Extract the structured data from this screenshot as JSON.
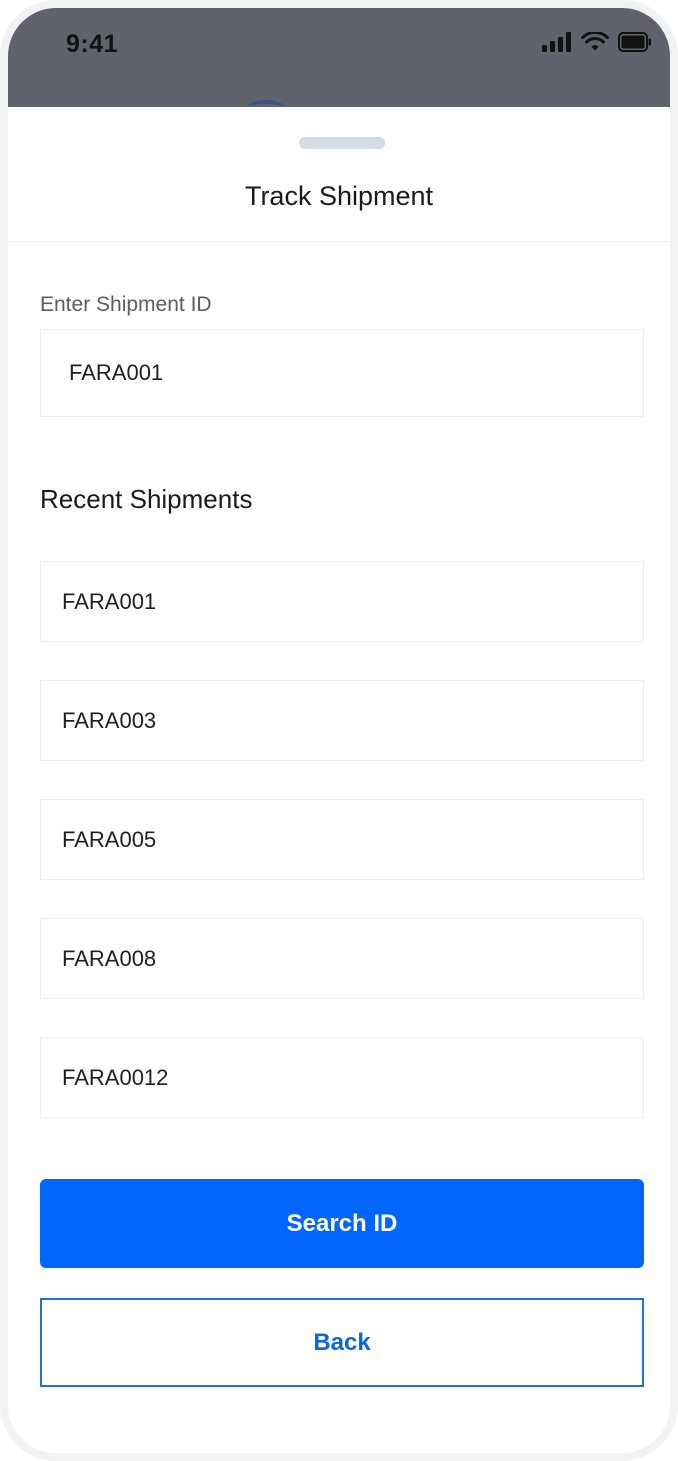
{
  "status_bar": {
    "time": "9:41",
    "icons": [
      "signal-icon",
      "wifi-icon",
      "battery-icon"
    ]
  },
  "sheet": {
    "title": "Track Shipment"
  },
  "form": {
    "label": "Enter Shipment ID",
    "value": "FARA001",
    "placeholder": ""
  },
  "recent": {
    "title": "Recent Shipments",
    "items": [
      "FARA001",
      "FARA003",
      "FARA005",
      "FARA008",
      "FARA0012"
    ]
  },
  "actions": {
    "primary_label": "Search ID",
    "secondary_label": "Back"
  },
  "colors": {
    "accent": "#0066FF",
    "backdrop": "#5F646C",
    "border": "#ECEEF1",
    "grabber": "#D5DBE5"
  }
}
